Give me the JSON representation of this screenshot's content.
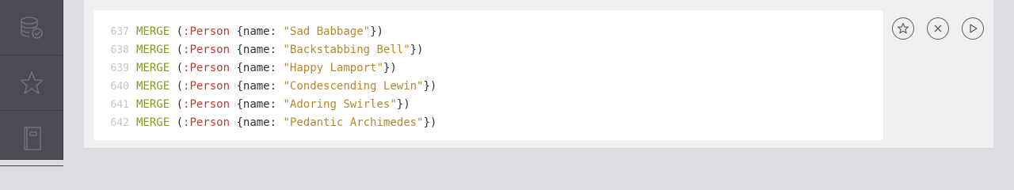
{
  "sidebar": {
    "items": [
      {
        "name": "database-icon"
      },
      {
        "name": "star-icon"
      },
      {
        "name": "book-icon"
      }
    ]
  },
  "editor": {
    "lines": [
      {
        "number": "637",
        "keyword": "MERGE",
        "open": " (",
        "label": ":Person",
        "brace_open": " {",
        "prop": "name:",
        "value": " \"Sad Babbage\"",
        "close": "})"
      },
      {
        "number": "638",
        "keyword": "MERGE",
        "open": " (",
        "label": ":Person",
        "brace_open": " {",
        "prop": "name:",
        "value": " \"Backstabbing Bell\"",
        "close": "})"
      },
      {
        "number": "639",
        "keyword": "MERGE",
        "open": " (",
        "label": ":Person",
        "brace_open": " {",
        "prop": "name:",
        "value": " \"Happy Lamport\"",
        "close": "})"
      },
      {
        "number": "640",
        "keyword": "MERGE",
        "open": " (",
        "label": ":Person",
        "brace_open": " {",
        "prop": "name:",
        "value": " \"Condescending Lewin\"",
        "close": "})"
      },
      {
        "number": "641",
        "keyword": "MERGE",
        "open": " (",
        "label": ":Person",
        "brace_open": " {",
        "prop": "name:",
        "value": " \"Adoring Swirles\"",
        "close": "})"
      },
      {
        "number": "642",
        "keyword": "MERGE",
        "open": " (",
        "label": ":Person",
        "brace_open": " {",
        "prop": "name:",
        "value": " \"Pedantic Archimedes\"",
        "close": "})"
      }
    ]
  },
  "actions": [
    {
      "name": "favorite-icon"
    },
    {
      "name": "clear-icon"
    },
    {
      "name": "run-icon"
    }
  ],
  "colors": {
    "sidebar": "#4b4b53",
    "keyword": "#7e9e15",
    "label": "#c0392b",
    "string": "#b8862b",
    "line_number": "#c6c6c6"
  }
}
